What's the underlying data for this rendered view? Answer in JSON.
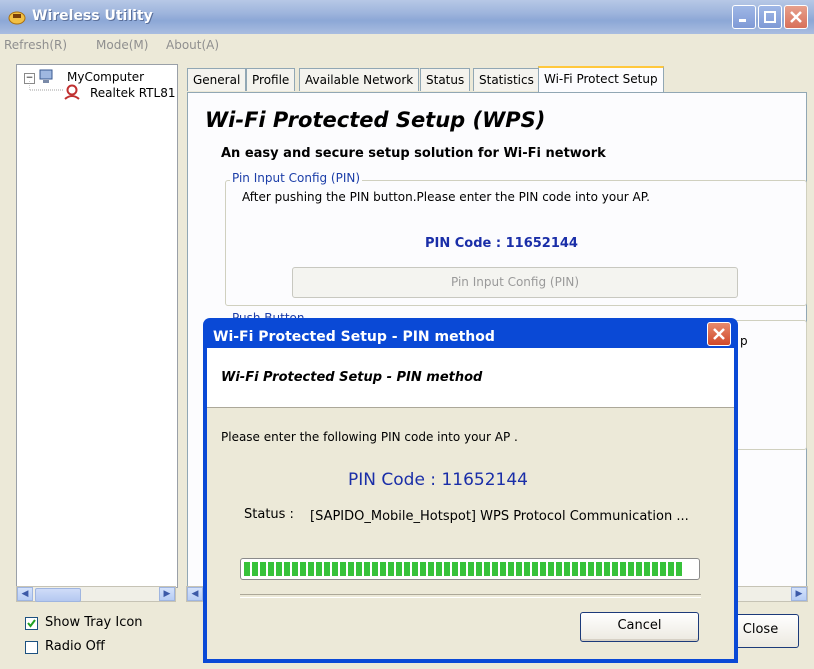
{
  "window": {
    "title": "Wireless Utility"
  },
  "menu": [
    "Refresh(R)",
    "Mode(M)",
    "About(A)"
  ],
  "tree": {
    "root": "MyComputer",
    "child": "Realtek RTL81"
  },
  "options": {
    "show_tray_icon": "Show Tray Icon",
    "show_tray_icon_checked": true,
    "radio_off": "Radio Off",
    "radio_off_checked": false
  },
  "tabs": [
    "General",
    "Profile",
    "Available Network",
    "Status",
    "Statistics",
    "Wi-Fi Protect Setup"
  ],
  "wps": {
    "title": "Wi-Fi Protected Setup (WPS)",
    "subtitle": "An easy and secure setup solution for Wi-Fi network",
    "pin_group_label": "Pin Input Config (PIN)",
    "pin_description": "After pushing the PIN button.Please enter the PIN code into your AP.",
    "pin_code": "PIN Code :  11652144",
    "pin_button": "Pin Input Config (PIN)",
    "push_group_label": "Push Button",
    "partial_right_text": "p",
    "close_button": "Close"
  },
  "dialog": {
    "title": "Wi-Fi Protected Setup - PIN method",
    "heading": "Wi-Fi Protected Setup - PIN method",
    "instruction": "Please enter the following PIN code into your AP .",
    "pin_code": "PIN Code :  11652144",
    "status_label": "Status :",
    "status_value": "[SAPIDO_Mobile_Hotspot] WPS Protocol Communication ...",
    "progress_fraction": 0.97,
    "cancel_button": "Cancel"
  },
  "colors": {
    "titlebar": "#9db4dc",
    "dialog_titlebar": "#0a49d6",
    "progress_green": "#37c23a",
    "pin_blue": "#1a2ea8"
  }
}
